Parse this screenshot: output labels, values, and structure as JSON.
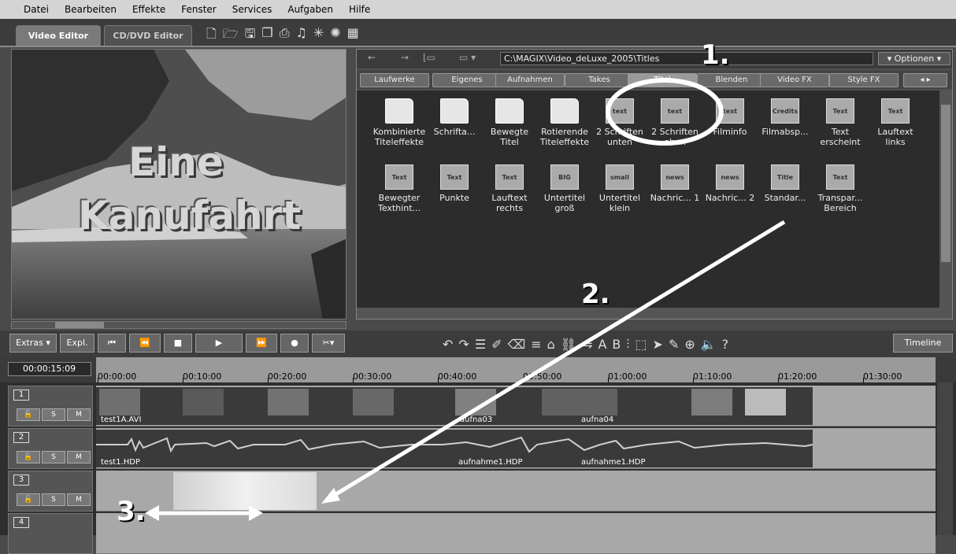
{
  "menu": [
    "Datei",
    "Bearbeiten",
    "Effekte",
    "Fenster",
    "Services",
    "Aufgaben",
    "Hilfe"
  ],
  "tabs": {
    "video_editor": "Video Editor",
    "cd_editor": "CD/DVD Editor"
  },
  "preview": {
    "title_line1": "Eine",
    "title_line2": "Kanufahrt"
  },
  "browser": {
    "path": "C:\\MAGIX\\Video_deLuxe_2005\\Titles",
    "options": "Optionen",
    "tabs": [
      "Laufwerke",
      "Eigenes",
      "Aufnahmen",
      "Takes",
      "Titel",
      "Blenden",
      "Video FX",
      "Style FX"
    ],
    "selected_tab": "Titel",
    "items_row1": [
      {
        "label": "Kombinierte Titeleffekte",
        "icon": "folder"
      },
      {
        "label": "Schrifta...",
        "icon": "folder"
      },
      {
        "label": "Bewegte Titel",
        "icon": "folder"
      },
      {
        "label": "Rotierende Titeleffekte",
        "icon": "folder"
      },
      {
        "label": "2 Schriften unten",
        "icon": "text"
      },
      {
        "label": "2 Schriften oben",
        "icon": "text"
      },
      {
        "label": "Filminfo",
        "icon": "text"
      },
      {
        "label": "Filmabsp...",
        "icon": "Credits"
      },
      {
        "label": "Text erscheint",
        "icon": "Text"
      },
      {
        "label": "Lauftext links",
        "icon": "Text"
      }
    ],
    "items_row2": [
      {
        "label": "Bewegter Texthint...",
        "icon": "Text"
      },
      {
        "label": "Punkte",
        "icon": "Text"
      },
      {
        "label": "Lauftext rechts",
        "icon": "Text"
      },
      {
        "label": "Untertitel groß",
        "icon": "BIG"
      },
      {
        "label": "Untertitel klein",
        "icon": "small"
      },
      {
        "label": "Nachric... 1",
        "icon": "news"
      },
      {
        "label": "Nachric... 2",
        "icon": "news"
      },
      {
        "label": "Standar...",
        "icon": "Title"
      },
      {
        "label": "Transpar... Bereich",
        "icon": "Text"
      }
    ]
  },
  "transport": {
    "extras": "Extras ▾",
    "expl": "Expl.",
    "timeline": "Timeline"
  },
  "timeline": {
    "timecode": "00:00:15:09",
    "ruler": [
      "00:00:00",
      "00:10:00",
      "00:20:00",
      "00:30:00",
      "00:40:00",
      "00:50:00",
      "01:00:00",
      "01:10:00",
      "01:20:00",
      "01:30:00"
    ],
    "tracks": [
      {
        "num": "1",
        "clips": [
          "test1A.AVI",
          "aufna03",
          "aufna04"
        ]
      },
      {
        "num": "2",
        "clips": [
          "test1.HDP",
          "aufnahme1.HDP",
          "aufnahme1.HDP"
        ]
      },
      {
        "num": "3",
        "clips": []
      },
      {
        "num": "4",
        "clips": []
      }
    ],
    "solo": "S",
    "mute": "M"
  },
  "annotations": {
    "a1": "1.",
    "a2": "2.",
    "a3": "3."
  }
}
